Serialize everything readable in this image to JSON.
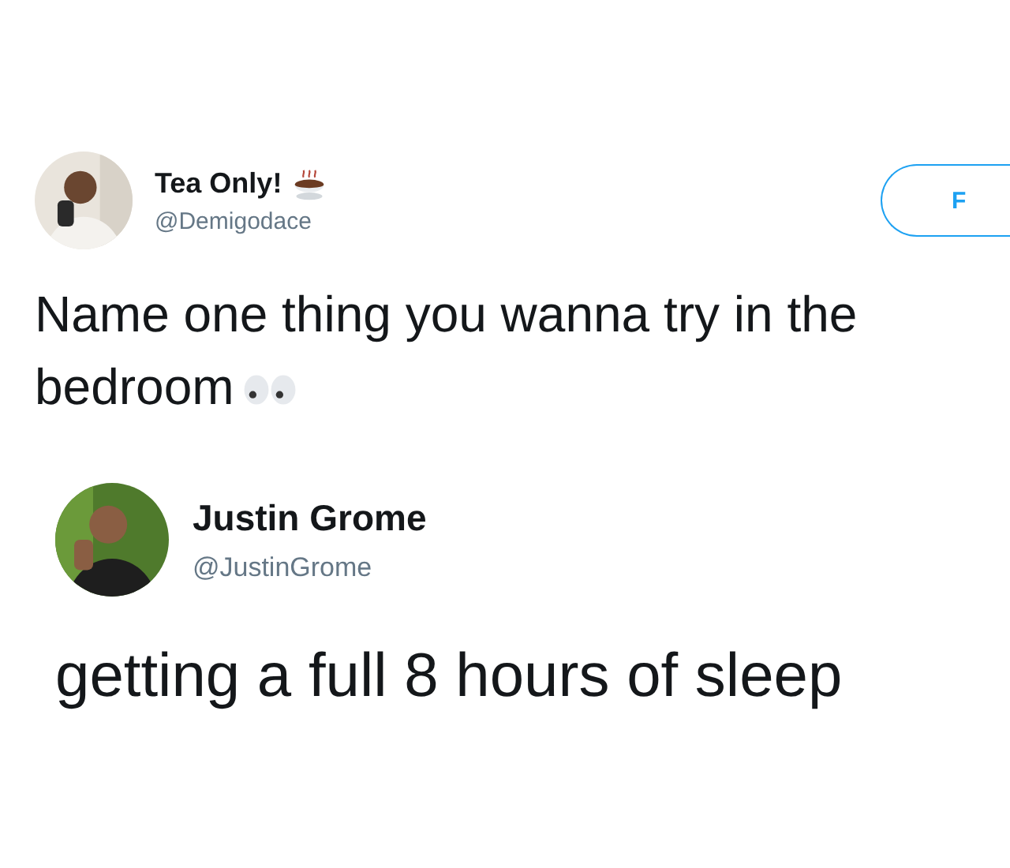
{
  "tweets": [
    {
      "name": "Tea Only!",
      "name_icon": {
        "kind": "teacup"
      },
      "handle": "@Demigodace",
      "follow_button": {
        "label": "F"
      },
      "text": "Name one thing you wanna try in the bedroom",
      "text_icon": {
        "kind": "eyes"
      }
    },
    {
      "name": "Justin Grome",
      "handle": "@JustinGrome",
      "text": "getting a full 8 hours of sleep"
    }
  ]
}
